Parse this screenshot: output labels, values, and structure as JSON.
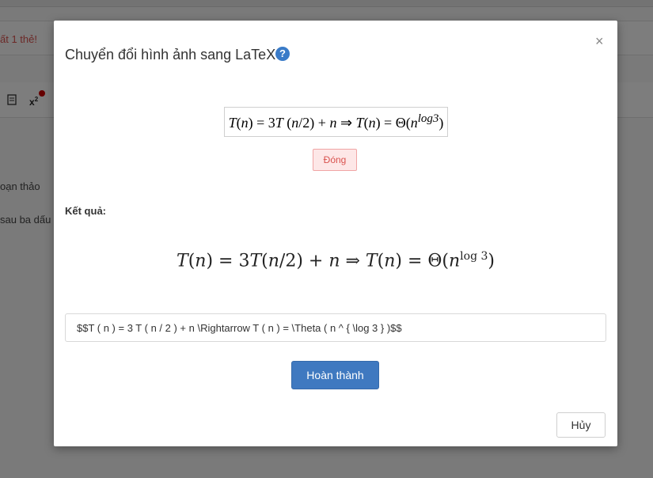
{
  "background": {
    "notice_text": "ất 1 thẻ!",
    "toolbar_superscript_base": "x",
    "toolbar_superscript_exp": "2",
    "line1": "oạn thảo",
    "line2": "sau ba dấu"
  },
  "modal": {
    "title": "Chuyển đổi hình ảnh sang LaTeX",
    "help_icon": "?",
    "close_icon": "×",
    "preview": {
      "T1": "T",
      "p1": "(",
      "n1": "n",
      "p2": ") = 3",
      "T2": "T",
      "p3": " (",
      "n2": "n",
      "p4": "/2) + ",
      "n3": "n",
      "arrow": " ⇒ ",
      "T3": "T",
      "p5": "(",
      "n4": "n",
      "p6": ") = Θ(",
      "n5": "n",
      "exp": "log3",
      "p7": ")"
    },
    "close_preview_label": "Đóng",
    "result_label": "Kết quả:",
    "rendered": {
      "T1": "T",
      "a1": "(",
      "n1": "n",
      "a2": ") = 3",
      "T2": "T",
      "a3": "(",
      "n2": "n",
      "a4": "/2) + ",
      "n3": "n",
      "arrow": " ⇒ ",
      "T3": "T",
      "a5": "(",
      "n4": "n",
      "a6": ") = Θ(",
      "n5": "n",
      "exp": "log 3",
      "a7": ")"
    },
    "latex_value": "$$T ( n ) = 3 T ( n / 2 ) + n \\Rightarrow T ( n ) = \\Theta ( n ^ { \\log 3 } )$$",
    "done_label": "Hoàn thành",
    "cancel_label": "Hủy"
  }
}
